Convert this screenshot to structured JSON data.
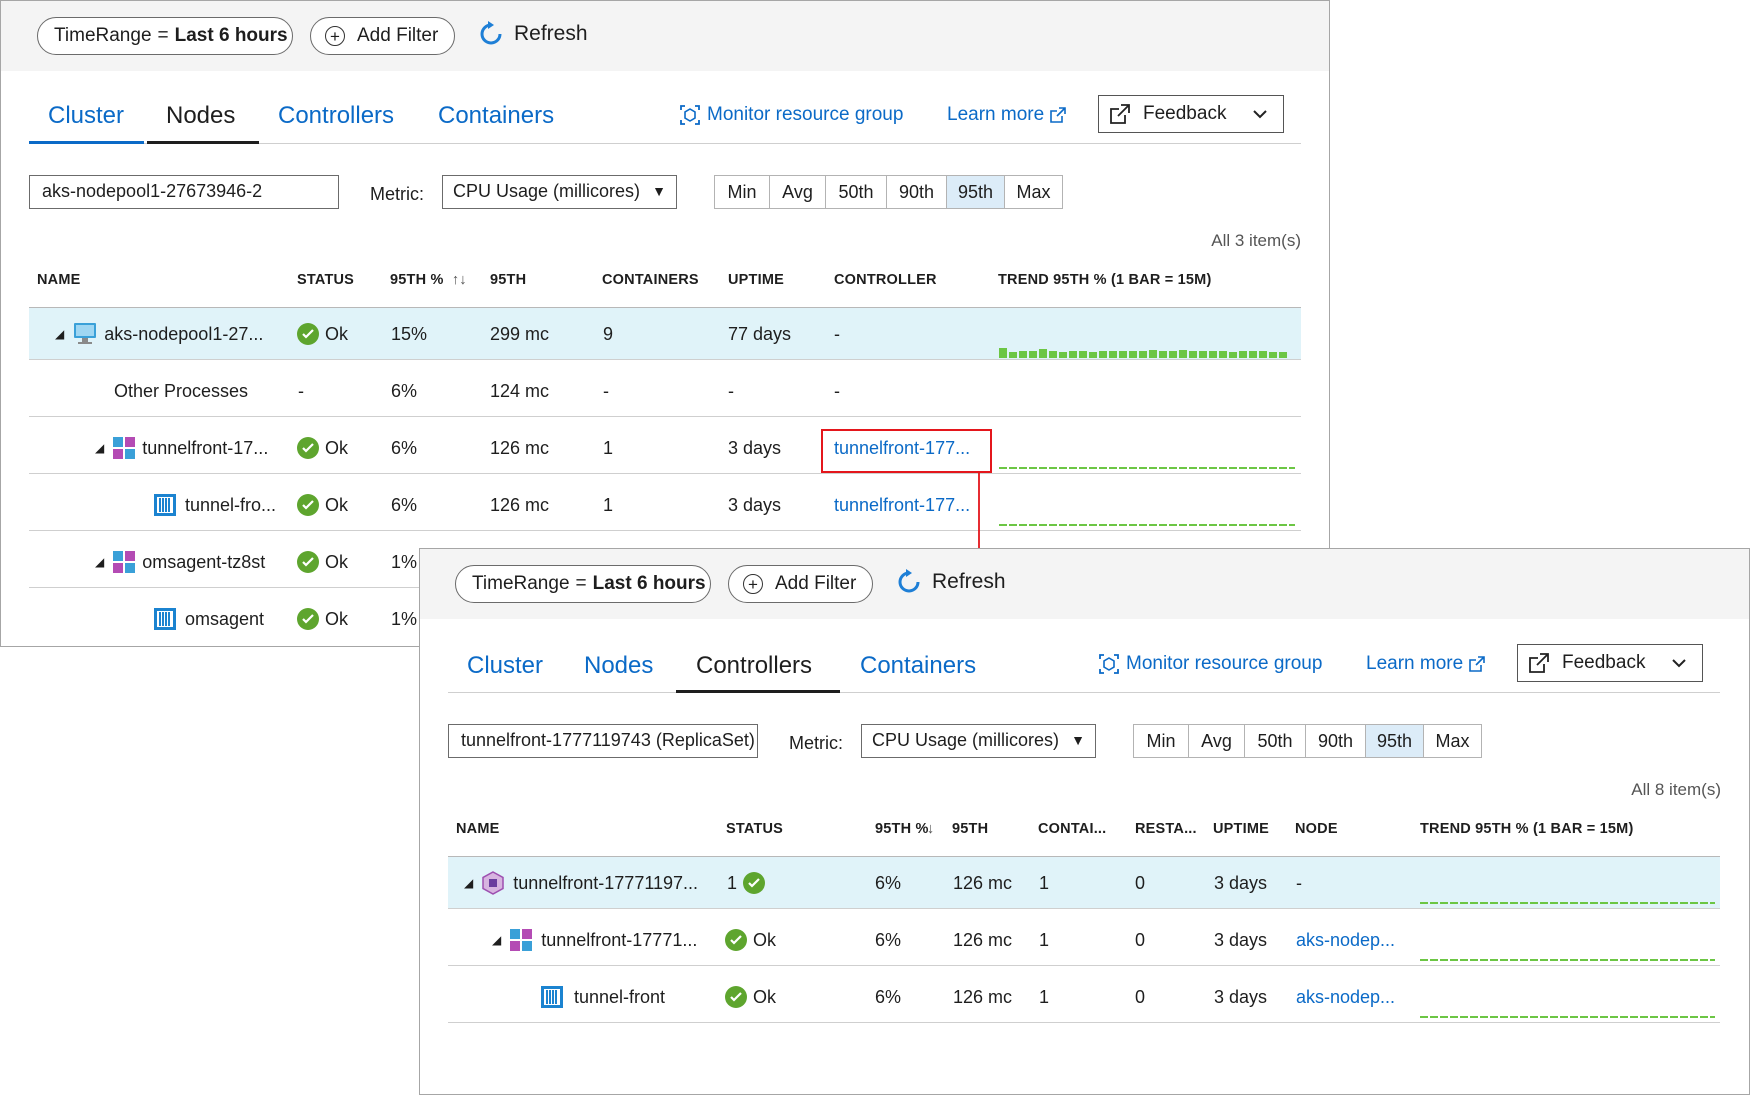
{
  "nodes_view": {
    "toolbar": {
      "time_key": "TimeRange",
      "time_eq": "=",
      "time_value": "Last 6 hours",
      "add_filter": "Add Filter",
      "refresh": "Refresh"
    },
    "tabs": [
      "Cluster",
      "Nodes",
      "Controllers",
      "Containers"
    ],
    "active_tab": "Nodes",
    "links": {
      "monitor": "Monitor resource group",
      "learn": "Learn more",
      "feedback": "Feedback"
    },
    "filter_value": "aks-nodepool1-27673946-2",
    "metric_label": "Metric:",
    "metric_value": "CPU Usage (millicores)",
    "percentiles": [
      "Min",
      "Avg",
      "50th",
      "90th",
      "95th",
      "Max"
    ],
    "selected_percentile": "95th",
    "count": "All 3 item(s)",
    "columns": [
      "NAME",
      "STATUS",
      "95TH %",
      "95TH",
      "CONTAINERS",
      "UPTIME",
      "CONTROLLER",
      "TREND 95TH % (1 BAR = 15M)"
    ],
    "rows": [
      {
        "name": "aks-nodepool1-27...",
        "status": "Ok",
        "pct": "15%",
        "val": "299 mc",
        "containers": "9",
        "uptime": "77 days",
        "controller": "-"
      },
      {
        "name": "Other Processes",
        "status": "-",
        "pct": "6%",
        "val": "124 mc",
        "containers": "-",
        "uptime": "-",
        "controller": "-"
      },
      {
        "name": "tunnelfront-17...",
        "status": "Ok",
        "pct": "6%",
        "val": "126 mc",
        "containers": "1",
        "uptime": "3 days",
        "controller": "tunnelfront-177..."
      },
      {
        "name": "tunnel-fro...",
        "status": "Ok",
        "pct": "6%",
        "val": "126 mc",
        "containers": "1",
        "uptime": "3 days",
        "controller": "tunnelfront-177..."
      },
      {
        "name": "omsagent-tz8st",
        "status": "Ok",
        "pct": "1%"
      },
      {
        "name": "omsagent",
        "status": "Ok",
        "pct": "1%"
      }
    ]
  },
  "controllers_view": {
    "toolbar": {
      "time_key": "TimeRange",
      "time_eq": "=",
      "time_value": "Last 6 hours",
      "add_filter": "Add Filter",
      "refresh": "Refresh"
    },
    "tabs": [
      "Cluster",
      "Nodes",
      "Controllers",
      "Containers"
    ],
    "active_tab": "Controllers",
    "links": {
      "monitor": "Monitor resource group",
      "learn": "Learn more",
      "feedback": "Feedback"
    },
    "filter_value": "tunnelfront-1777119743 (ReplicaSet)",
    "metric_label": "Metric:",
    "metric_value": "CPU Usage (millicores)",
    "percentiles": [
      "Min",
      "Avg",
      "50th",
      "90th",
      "95th",
      "Max"
    ],
    "selected_percentile": "95th",
    "count": "All 8 item(s)",
    "columns": [
      "NAME",
      "STATUS",
      "95TH %",
      "95TH",
      "CONTAI...",
      "RESTA...",
      "UPTIME",
      "NODE",
      "TREND 95TH % (1 BAR = 15M)"
    ],
    "rows": [
      {
        "name": "tunnelfront-17771197...",
        "status": "1",
        "pct": "6%",
        "val": "126 mc",
        "containers": "1",
        "restarts": "0",
        "uptime": "3 days",
        "node": "-"
      },
      {
        "name": "tunnelfront-17771...",
        "status": "Ok",
        "pct": "6%",
        "val": "126 mc",
        "containers": "1",
        "restarts": "0",
        "uptime": "3 days",
        "node": "aks-nodep..."
      },
      {
        "name": "tunnel-front",
        "status": "Ok",
        "pct": "6%",
        "val": "126 mc",
        "containers": "1",
        "restarts": "0",
        "uptime": "3 days",
        "node": "aks-nodep..."
      }
    ]
  }
}
